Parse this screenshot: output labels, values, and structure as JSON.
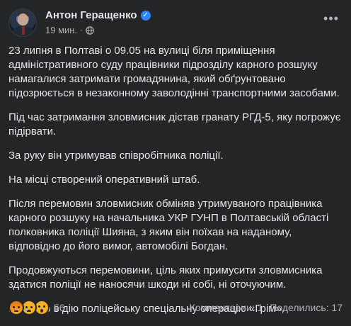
{
  "post": {
    "author": "Антон Геращенко",
    "time": "19 мин.",
    "privacy_icon": "globe-icon",
    "verified_icon": "verified-check-icon",
    "paragraphs": [
      "23 липня в Полтаві о 09.05 на вулиці біля приміщення адміністративного суду працівники підрозділу карного розшуку намагалися затримати громадянина, який обґрунтовано підозрюється в незаконному заволодінні транспортними засобами.",
      "Під час затримання зловмисник дістав гранату РГД-5, яку погрожує підірвати.",
      "За руку він утримував  співробітника поліції.",
      "На місці створений оперативний штаб.",
      "Після перемовин зловмисник обміняв утримуваного працівника карного розшуку на начальника УКР ГУНП в Полтавській області полковника поліції Шияна, з яким він поїхав на наданому, відповідно до його вимог, автомобілі Богдан.",
      "Продовжуються  перемовини, ціль яких примусити  зловмисника здатися поліції  не наносячи шкоди ні собі, ні оточуючим.",
      "Введено в дію поліцейську спеціальну операцію «Грім»."
    ]
  },
  "footer": {
    "reactions": [
      "angry",
      "sad",
      "wow"
    ],
    "reaction_count": "56",
    "comments": "Комментарии: 1",
    "shares": "Поделились: 17"
  },
  "colors": {
    "background": "#242526",
    "text_primary": "#e4e6eb",
    "text_secondary": "#b0b3b8",
    "verified": "#2d88ff"
  }
}
